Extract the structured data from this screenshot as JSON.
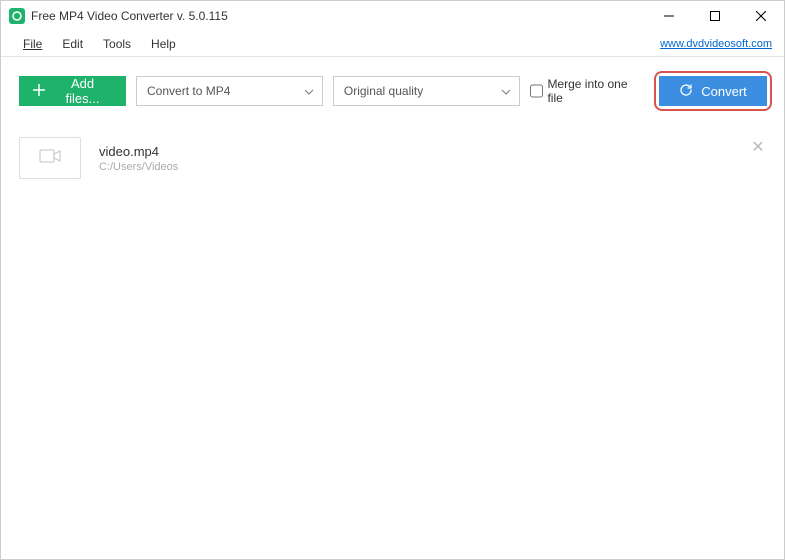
{
  "window": {
    "title": "Free MP4 Video Converter v. 5.0.115"
  },
  "menubar": {
    "file": "File",
    "edit": "Edit",
    "tools": "Tools",
    "help": "Help",
    "website": "www.dvdvideosoft.com"
  },
  "toolbar": {
    "add_files": "Add files...",
    "format_selected": "Convert to MP4",
    "quality_selected": "Original quality",
    "merge_label": "Merge into one file",
    "convert": "Convert"
  },
  "files": [
    {
      "name": "video.mp4",
      "path": "C:/Users/Videos"
    }
  ]
}
